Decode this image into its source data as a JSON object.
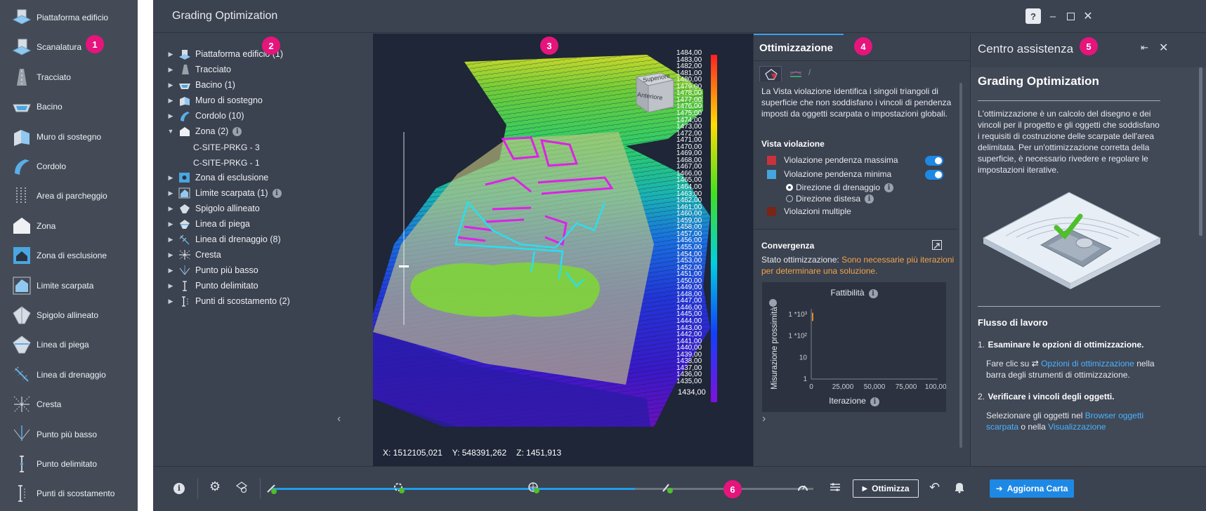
{
  "palette": {
    "items": [
      {
        "label": "Piattaforma edificio",
        "icon": "building-pad-icon"
      },
      {
        "label": "Scanalatura",
        "icon": "scoring-icon"
      },
      {
        "label": "Tracciato",
        "icon": "road-path-icon"
      },
      {
        "label": "Bacino",
        "icon": "pond-icon"
      },
      {
        "label": "Muro di sostegno",
        "icon": "retaining-wall-icon"
      },
      {
        "label": "Cordolo",
        "icon": "curb-icon"
      },
      {
        "label": "Area di parcheggio",
        "icon": "parking-area-icon"
      },
      {
        "label": "Zona",
        "icon": "zone-icon"
      },
      {
        "label": "Zona di esclusione",
        "icon": "exclusion-zone-icon"
      },
      {
        "label": "Limite scarpata",
        "icon": "grading-limit-icon"
      },
      {
        "label": "Spigolo allineato",
        "icon": "aligned-edge-icon"
      },
      {
        "label": "Linea di piega",
        "icon": "fold-line-icon"
      },
      {
        "label": "Linea di drenaggio",
        "icon": "drainage-line-icon"
      },
      {
        "label": "Cresta",
        "icon": "ridge-icon"
      },
      {
        "label": "Punto più basso",
        "icon": "low-point-icon"
      },
      {
        "label": "Punto delimitato",
        "icon": "bounded-point-icon"
      },
      {
        "label": "Punti di scostamento",
        "icon": "offset-points-icon"
      }
    ]
  },
  "app": {
    "title": "Grading Optimization"
  },
  "browser": {
    "items": [
      {
        "label": "Piattaforma edificio (1)",
        "expanded": false,
        "info": false
      },
      {
        "label": "Tracciato",
        "expanded": false,
        "info": false
      },
      {
        "label": "Bacino (1)",
        "expanded": false,
        "info": false
      },
      {
        "label": "Muro di sostegno",
        "expanded": false,
        "info": false
      },
      {
        "label": "Cordolo (10)",
        "expanded": false,
        "info": false
      },
      {
        "label": "Zona (2)",
        "expanded": true,
        "info": true
      },
      {
        "label": "Zona di esclusione",
        "expanded": false,
        "info": false
      },
      {
        "label": "Limite scarpata (1)",
        "expanded": false,
        "info": true
      },
      {
        "label": "Spigolo allineato",
        "expanded": false,
        "info": false
      },
      {
        "label": "Linea di piega",
        "expanded": false,
        "info": false
      },
      {
        "label": "Linea di drenaggio (8)",
        "expanded": false,
        "info": false
      },
      {
        "label": "Cresta",
        "expanded": false,
        "info": false
      },
      {
        "label": "Punto più basso",
        "expanded": false,
        "info": false
      },
      {
        "label": "Punto delimitato",
        "expanded": false,
        "info": false
      },
      {
        "label": "Punti di scostamento (2)",
        "expanded": false,
        "info": false
      }
    ],
    "zone_children": [
      "C-SITE-PRKG - 3",
      "C-SITE-PRKG - 1"
    ]
  },
  "viewport": {
    "coords": {
      "x": "X: 1512105,021",
      "y": "Y: 548391,262",
      "z": "Z: 1451,913"
    },
    "viewcube": {
      "top": "Superiore",
      "front": "Anteriore"
    },
    "scale": {
      "labels": [
        "1484,00",
        "1483,00",
        "1482,00",
        "1481,00",
        "1480,00",
        "1479,00",
        "1478,00",
        "1477,00",
        "1476,00",
        "1475,00",
        "1474,00",
        "1473,00",
        "1472,00",
        "1471,00",
        "1470,00",
        "1469,00",
        "1468,00",
        "1467,00",
        "1466,00",
        "1465,00",
        "1464,00",
        "1463,00",
        "1462,00",
        "1461,00",
        "1460,00",
        "1459,00",
        "1458,00",
        "1457,00",
        "1456,00",
        "1455,00",
        "1454,00",
        "1453,00",
        "1452,00",
        "1451,00",
        "1450,00",
        "1449,00",
        "1448,00",
        "1447,00",
        "1446,00",
        "1445,00",
        "1444,00",
        "1443,00",
        "1442,00",
        "1441,00",
        "1440,00",
        "1439,00",
        "1438,00",
        "1437,00",
        "1436,00",
        "1435,00"
      ],
      "bottom_label": "1434,00"
    }
  },
  "optimization": {
    "tab": "Ottimizzazione",
    "description": "La Vista violazione identifica i singoli triangoli di superficie che non soddisfano i vincoli di pendenza imposti da oggetti scarpata o impostazioni globali.",
    "violation_title": "Vista violazione",
    "violations": [
      {
        "label": "Violazione pendenza massima",
        "color": "#c8323c",
        "toggle": true
      },
      {
        "label": "Violazione pendenza minima",
        "color": "#45a5de",
        "toggle": true
      }
    ],
    "radio": [
      {
        "label": "Direzione di drenaggio",
        "checked": true
      },
      {
        "label": "Direzione distesa",
        "checked": false
      }
    ],
    "multiple": {
      "label": "Violazioni multiple",
      "color": "#7a2515"
    },
    "convergence_title": "Convergenza",
    "status_label": "Stato ottimizzazione:",
    "status_value": "Sono necessarie più iterazioni per determinare una soluzione.",
    "status_color": "#f0a44a"
  },
  "chart_data": {
    "type": "line",
    "title": "Fattibilità",
    "xlabel": "Iterazione",
    "ylabel": "Misurazione prossimità",
    "x_ticks": [
      "0",
      "25,000",
      "50,000",
      "75,000",
      "100,000"
    ],
    "y_ticks": [
      "1",
      "10",
      "1 *10²",
      "1 *10³"
    ],
    "xlim": [
      0,
      100000
    ],
    "ylim": [
      1,
      1000
    ],
    "yscale": "log",
    "series": [
      {
        "x": [
          0,
          0
        ],
        "y": [
          500,
          1200
        ],
        "color": "#e08a2a"
      }
    ]
  },
  "help": {
    "title": "Centro assistenza",
    "heading": "Grading Optimization",
    "intro": "L'ottimizzazione è un calcolo del disegno e dei vincoli per il progetto e gli oggetti che soddisfano i requisiti di costruzione delle scarpate dell'area delimitata. Per un'ottimizzazione corretta della superficie, è necessario rivedere e regolare le impostazioni iterative.",
    "workflow_title": "Flusso di lavoro",
    "steps": [
      {
        "num": "1.",
        "title": "Esaminare le opzioni di ottimizzazione.",
        "text_pre": "Fare clic su",
        "link": "Opzioni di ottimizzazione",
        "text_post": "nella barra degli strumenti di ottimizzazione."
      },
      {
        "num": "2.",
        "title": "Verificare i vincoli degli oggetti.",
        "text_pre": "Selezionare gli oggetti nel",
        "link": "Browser oggetti scarpata",
        "text_post": "o nella",
        "link2": "Visualizzazione"
      }
    ]
  },
  "toolbar": {
    "optimize_label": "Ottimizza",
    "update_label": "Aggiorna Carta",
    "progress": 0.67
  },
  "callouts": [
    "1",
    "2",
    "3",
    "4",
    "5",
    "6"
  ]
}
